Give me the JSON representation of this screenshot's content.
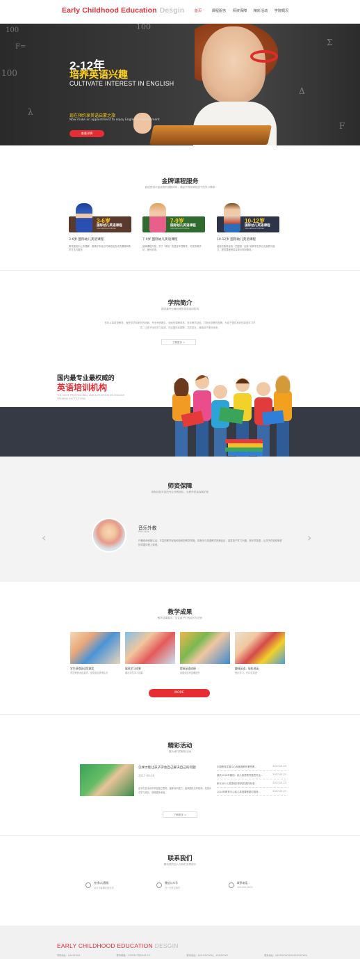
{
  "header": {
    "logo": "Early Childhood Education",
    "logo_sub": "Desgin",
    "nav": [
      "首页",
      "课程服务",
      "师资保障",
      "精彩活动",
      "学院概况"
    ],
    "active_index": 0
  },
  "hero": {
    "age": "2-12年",
    "title_cn": "培养英语兴趣",
    "title_en": "CULTIVATE INTEREST IN ENGLISH",
    "sub_cn": "现在预约享英语启蒙之旅",
    "sub_en": "Now make an appointment to enjoy English Enlightenment",
    "button": "查看详情",
    "chalk": [
      "2-12年",
      "100",
      "F=",
      "100",
      "Σ",
      "Δ",
      "λ",
      "F"
    ]
  },
  "courses": {
    "title": "金牌课程服务",
    "subtitle": "我们提供丰富优质的课程体系，满足不同年龄段孩子的学习需求",
    "items": [
      {
        "age": "3-6岁",
        "cn": "国际幼儿英语课程",
        "en": "International Children",
        "name": "3-6岁 国际幼儿英语课程",
        "desc": "教育服务中心的理解，推荐好多经过时间检验的优质课程和教学方法与服务",
        "color": "#5a3a2c"
      },
      {
        "age": "7-9岁",
        "cn": "国际幼儿英语课程",
        "en": "International Children",
        "name": "7-9岁 国际幼儿英语课程",
        "desc": "品牌课程开发，关于 “体验” 的语言环境教学，可靠的教学记，家长反馈。",
        "color": "#2f6b2f"
      },
      {
        "age": "10-12岁",
        "cn": "国际幼儿英语课程",
        "en": "International Children",
        "name": "10-12岁 国际幼儿英语课程",
        "desc": "经常的教育经验一些配套 “全能”培养学生多元化素质与能力，提供课程研发及成长规划服务。",
        "color": "#2d3448"
      }
    ]
  },
  "intro": {
    "title": "学院简介",
    "subtitle": "国内最专业最权威的英语培训机构",
    "text": "多年从事英语教育，深受学员和家长的信赖。专业师资团队，全面的课程体系，多年教学经验，打造优质教育品牌，为孩子提供良好的英语学习环境，让孩子快乐学习英语，开启国际化视野，共同成长，铸造孩子美好未来。",
    "button": "了解更多 >"
  },
  "banner2": {
    "cn1": "国内最专业最权威的",
    "cn2": "英语培训机构",
    "en": "THE MOST PROFESSIONAL AND AUTHORITATIVE ENGLISH TRAINING INSTITUTIONS"
  },
  "teachers": {
    "title": "师资保障",
    "subtitle": "拥有经验丰富的专业外教团队，为教学质量保驾护航",
    "name": "音乐外教",
    "en": "Proludica",
    "desc": "外籍老师资格认证，丰富的教学经验和亲和的教学风格，将音乐与英语教学完美结合，激发孩子学习兴趣，快乐学英语，让孩子在轻松愉悦的氛围中爱上英语。",
    "prev": "‹",
    "next": "›"
  },
  "results": {
    "title": "教学成果",
    "subtitle": "教学成果展示，见证孩子们的成长与进步",
    "items": [
      {
        "t": "学生获得英语竞赛奖",
        "d": "学员荣获大赛奖项，优秀成绩获得认可"
      },
      {
        "t": "展现学习成果",
        "d": "展示学员学习成果"
      },
      {
        "t": "提高英语成绩",
        "d": "英语成绩有显著提升"
      },
      {
        "t": "趣味英语，轻松说英",
        "d": "快乐学习，开口说英语"
      }
    ],
    "button": "MORE"
  },
  "activities": {
    "title": "精彩活动",
    "subtitle": "展示我们的精彩活动",
    "feature_title": "怎样才能让孩子学会自己解决自己的问题",
    "feature_date": "2017-06-28",
    "feature_desc": "孩子们在活动中学会独立思考，锻炼动手能力，培养团队合作精神，在快乐中学习成长，获得更多体验。",
    "news": [
      {
        "t": "中国教育发展中心和美国教育署签署...",
        "d": "2017-05-23"
      },
      {
        "t": "重庆2016年春招：幼儿英语教育备受关注...",
        "d": "2017-05-23"
      },
      {
        "t": "家长对少儿英语培训机构的选择标准...",
        "d": "2017-05-23"
      },
      {
        "t": "2016年教育中心幼儿英语课程精彩推荐...",
        "d": "2017-05-23"
      }
    ],
    "button": "了解更多 >"
  },
  "contact": {
    "title": "联系我们",
    "subtitle": "期待您的加入与我们共同成长",
    "items": [
      {
        "a": "在线QQ客服",
        "b": "点击与客服在线交流"
      },
      {
        "a": "微信公众号",
        "b": "扫一扫关注我们"
      },
      {
        "a": "联系电话",
        "b": "400-000-0000"
      }
    ]
  },
  "footer": {
    "logo": "EARLY CHILDHOOD EDUCATION",
    "logo_sub": "DESGIN",
    "info": [
      "学校地址：XXXXXXXX",
      "联系邮箱：CONTACT@XXXX.CO",
      "联系电话：XXX-XXXXXXX，XXXXXXXX",
      "联系地址：XXXXXXXXXXXXXXXXXXXXX"
    ]
  },
  "colors": {
    "accent": "#e52d33",
    "yellow": "#ffd21f",
    "dark": "#363a45"
  }
}
